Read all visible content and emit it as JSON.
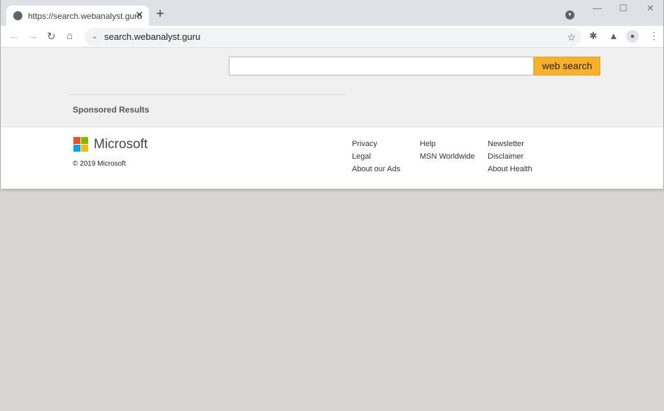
{
  "browser": {
    "tab_title": "https://search.webanalyst.guru",
    "url": "search.webanalyst.guru"
  },
  "search": {
    "value": "",
    "button_label": "web search"
  },
  "sponsored": "Sponsored Results",
  "footer": {
    "brand": "Microsoft",
    "copyright": "© 2019 Microsoft",
    "columns": [
      [
        "Privacy",
        "Legal",
        "About our Ads"
      ],
      [
        "Help",
        "MSN Worldwide"
      ],
      [
        "Newsletter",
        "Disclaimer",
        "About Health"
      ]
    ]
  },
  "colors": {
    "button": "#f9b12a",
    "logo": [
      "#f25022",
      "#7fba00",
      "#00a4ef",
      "#ffb900"
    ]
  }
}
